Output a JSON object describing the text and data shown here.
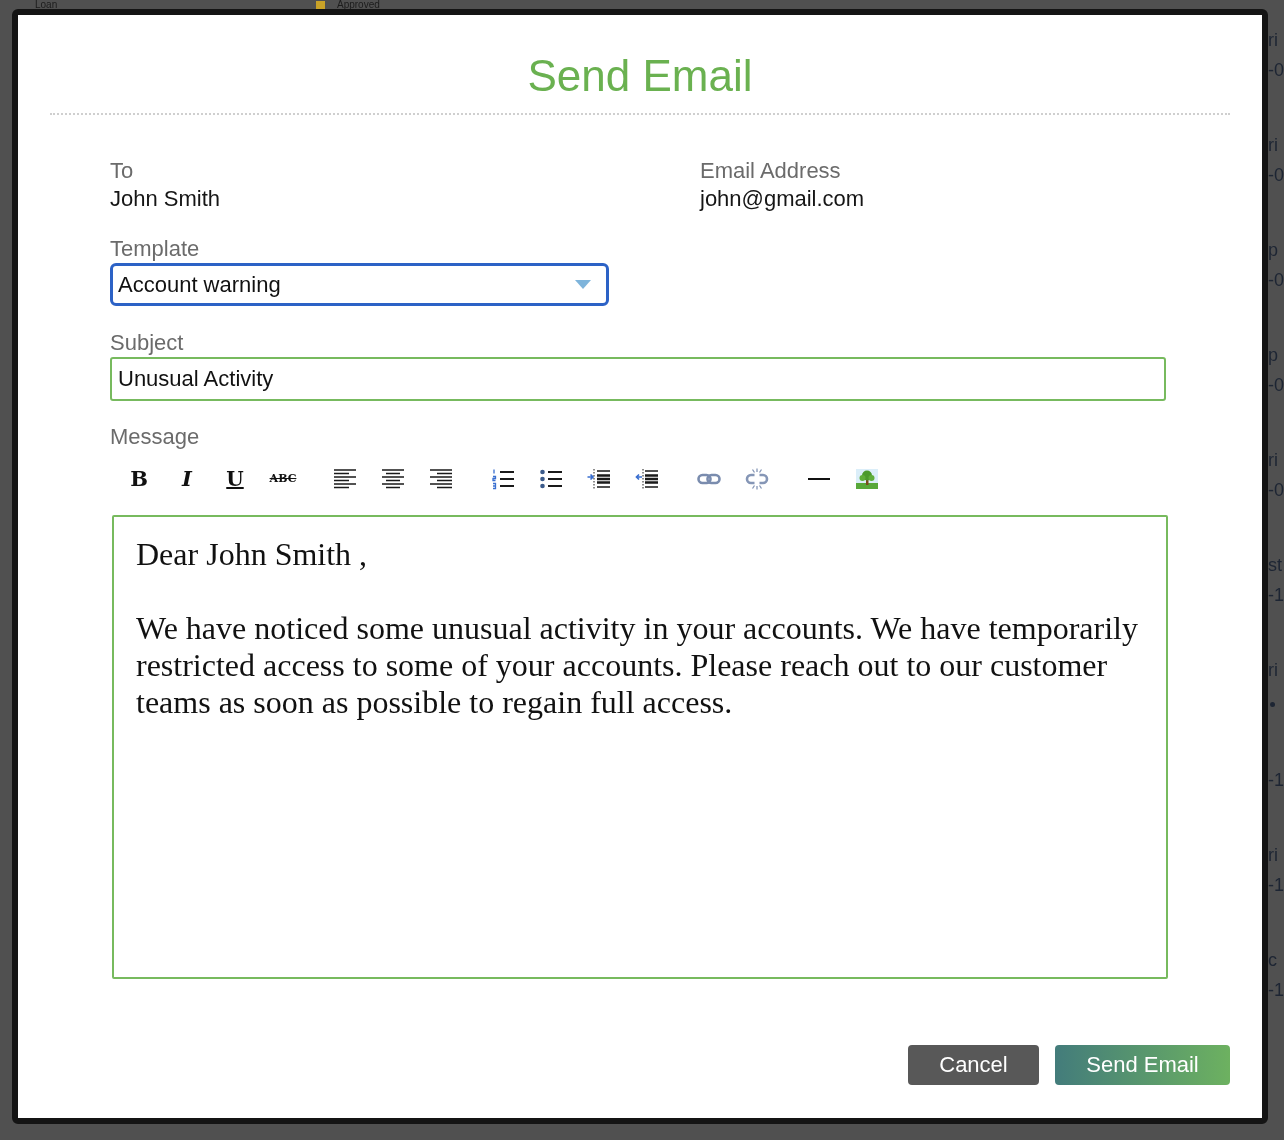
{
  "backdrop": {
    "header": [
      {
        "kind": "text",
        "text": "Loan"
      },
      {
        "kind": "status",
        "text": "Approved",
        "color": "#c9a227"
      }
    ],
    "side_rows": [
      {
        "kind": "plain",
        "title": "ri",
        "date": "-0"
      },
      {
        "kind": "plain",
        "title": "ri",
        "date": "-0"
      },
      {
        "kind": "plain",
        "title": "p",
        "date": "-0"
      },
      {
        "kind": "plain",
        "title": "p",
        "date": "-0"
      },
      {
        "kind": "plain",
        "title": "ri",
        "date": "-0"
      },
      {
        "kind": "plain",
        "title": "st",
        "date": "-1"
      },
      {
        "kind": "bulleted",
        "title": "ri",
        "date": "-1"
      },
      {
        "kind": "plain",
        "title": "ri",
        "date": "-1"
      },
      {
        "kind": "plain",
        "title": "c",
        "date": "-1"
      }
    ]
  },
  "dialog": {
    "title": "Send Email",
    "recipient": {
      "label": "To",
      "value": "John Smith"
    },
    "email": {
      "label": "Email Address",
      "value": "john@gmail.com"
    },
    "template": {
      "label": "Template",
      "value": "Account warning",
      "focused": true
    },
    "subject": {
      "label": "Subject",
      "value": "Unusual Activity"
    },
    "message": {
      "label": "Message",
      "toolbar": [
        [
          {
            "kind": "bold",
            "glyph": "B"
          },
          {
            "kind": "italic",
            "glyph": "I"
          },
          {
            "kind": "underline",
            "glyph": "U"
          },
          {
            "kind": "strikethrough",
            "glyph": "ABC"
          }
        ],
        [
          {
            "kind": "align-left"
          },
          {
            "kind": "align-center"
          },
          {
            "kind": "align-right"
          }
        ],
        [
          {
            "kind": "numbered-list"
          },
          {
            "kind": "bullet-list"
          },
          {
            "kind": "indent"
          },
          {
            "kind": "outdent"
          }
        ],
        [
          {
            "kind": "link"
          },
          {
            "kind": "unlink"
          }
        ],
        [
          {
            "kind": "horizontal-rule"
          },
          {
            "kind": "image"
          }
        ]
      ],
      "paragraphs": [
        "Dear John Smith ,",
        "We have noticed some unusual activity in your accounts. We have temporarily restricted access to some of your accounts. Please reach out to our customer teams as soon as possible to regain full access."
      ]
    },
    "buttons": [
      {
        "kind": "secondary",
        "label": "Cancel"
      },
      {
        "kind": "primary",
        "label": "Send Email"
      }
    ]
  }
}
